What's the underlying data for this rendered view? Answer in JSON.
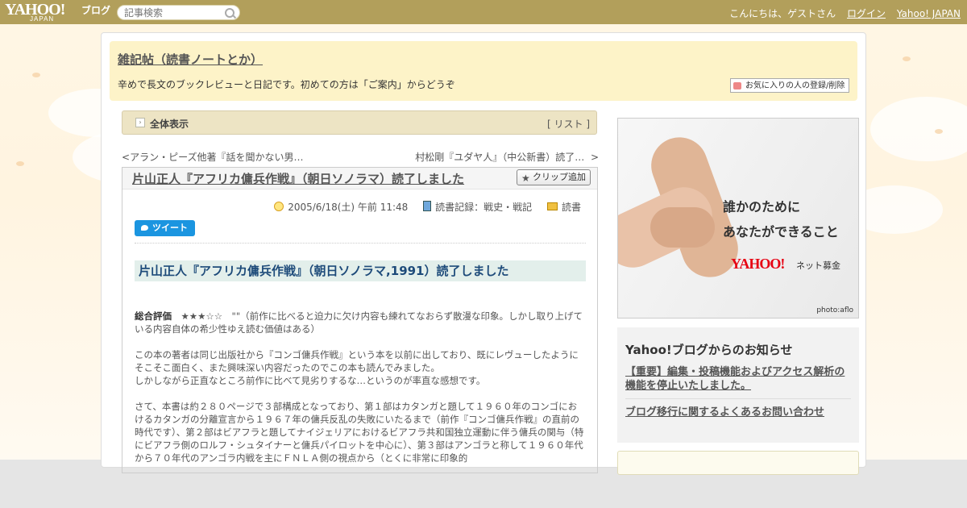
{
  "topbar": {
    "logo": "YAHOO!",
    "logo_sub": "JAPAN",
    "logo_blog": "ブログ",
    "search_placeholder": "記事検索",
    "greeting": "こんにちは、ゲストさん",
    "login": "ログイン",
    "yahoo_japan": "Yahoo! JAPAN"
  },
  "header": {
    "blog_title": "雑記帖（読書ノートとか）",
    "description": "辛めで長文のブックレビューと日記です。初めての方は「ご案内」からどうぞ",
    "favorite_button": "お気に入りの人の登録/削除"
  },
  "allbar": {
    "label": "全体表示",
    "list_open": "[ ",
    "list_link": "リスト",
    "list_close": " ]"
  },
  "nav": {
    "prev_mark": "<",
    "prev": "アラン・ピーズ他著『話を聞かない男…",
    "next": "村松剛『ユダヤ人』（中公新書）読了…",
    "next_mark": ">"
  },
  "article": {
    "title": "片山正人『アフリカ傭兵作戦』（朝日ソノラマ）読了しました",
    "clip_button": "クリップ追加",
    "date": "2005/6/18(土) 午前 11:48",
    "category": "読書記録：戦史・戦記",
    "folder": "読書",
    "tweet": "ツイート",
    "subtitle": "片山正人『アフリカ傭兵作戦』（朝日ソノラマ,1991）読了しました",
    "rating_label": "総合評価",
    "rating_rest": "　★★★☆☆　\"\"（前作に比べると迫力に欠け内容も練れてなおらず散漫な印象。しかし取り上げている内容自体の希少性ゆえ読む価値はある）",
    "para1_line1": "この本の著者は同じ出版社から『コンゴ傭兵作戦』という本を以前に出しており、既にレヴューしたようにそこそこ面白く、また興味深い内容だったのでこの本も読んでみました。",
    "para1_line2": "しかしながら正直なところ前作に比べて見劣りするな…というのが率直な感想です。",
    "para2": "さて、本書は約２８０ページで３部構成となっており、第１部はカタンガと題して１９６０年のコンゴにおけるカタンガの分離宣言から１９６７年の傭兵反乱の失敗にいたるまで（前作『コンゴ傭兵作戦』の直前の時代です）、第２部はビアフラと題してナイジェリアにおけるビアフラ共和国独立運動に伴う傭兵の関与（特にビアフラ側のロルフ・シュタイナーと傭兵パイロットを中心に）、第３部はアンゴラと称して１９６０年代から７０年代のアンゴラ内戦を主にＦＮＬＡ側の視点から（とくに非常に印象的"
  },
  "ad": {
    "line1": "誰かのために",
    "line2": "あなたができること",
    "logo": "YAHOO!",
    "tag": "ネット募金",
    "credit": "photo:aflo"
  },
  "notice": {
    "title": "Yahoo!ブログからのお知らせ",
    "item1": "【重要】編集・投稿機能およびアクセス解析の機能を停止いたしました。",
    "item2": "ブログ移行に関するよくあるお問い合わせ"
  }
}
